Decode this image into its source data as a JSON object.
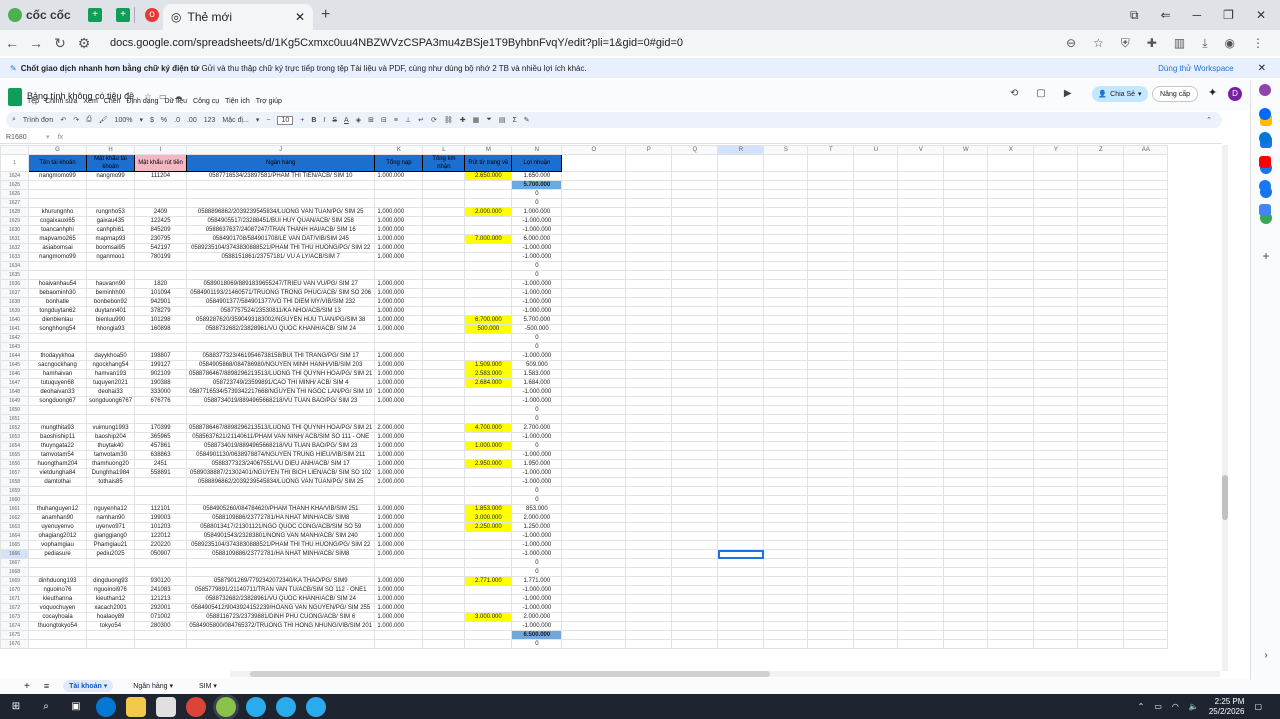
{
  "browser": {
    "brand": "cốc cốc",
    "active_tab": "Thẻ mới",
    "url": "docs.google.com/spreadsheets/d/1Kg5Cxmxc0uu4NBZWVzCSPA3mu4zBSje1T9ByhbnFvqY/edit?pli=1&gid=0#gid=0"
  },
  "banner": {
    "bold": "Chốt giao dịch nhanh hơn bằng chữ ký điện tử",
    "text": "Gửi và thu thập chữ ký trực tiếp trong tệp Tài liệu và PDF, cùng như dùng bộ nhớ 2 TB và nhiều lợi ích khác.",
    "cta": "Dùng thử Workspace"
  },
  "docs": {
    "title": "Bảng tính không có tiêu đề",
    "menu": [
      "Tệp",
      "Chỉnh sửa",
      "Xem",
      "Chèn",
      "Định dạng",
      "Dữ liệu",
      "Công cụ",
      "Tiện ích",
      "Trợ giúp"
    ],
    "share": "Chia Sẻ",
    "upgrade": "Nâng cấp",
    "avatar": "D"
  },
  "toolbar": {
    "search": "Trình đơn",
    "zoom": "100%",
    "pct": "%",
    "dec1": ".0",
    "dec2": ".00",
    "num": "123",
    "font": "Mặc đị...",
    "fontsize": "10"
  },
  "formula": {
    "cellref": "R1680",
    "fx": "fx"
  },
  "columns": [
    "G",
    "H",
    "I",
    "J",
    "K",
    "L",
    "M",
    "N",
    "O",
    "P",
    "Q",
    "R",
    "S",
    "T",
    "U",
    "V",
    "W",
    "X",
    "Y",
    "Z",
    "AA"
  ],
  "headers": {
    "g": "Tên tài khoản",
    "h": "Mật khẩu tài khoản",
    "i": "Mật khẩu rút tiền",
    "j": "Ngân hàng",
    "k": "Tổng nạp",
    "l": "Tổng km nhận",
    "m": "Rút từ trang về",
    "n": "Lợi nhuận"
  },
  "rows": [
    {
      "n": "1624",
      "g": "nangmomo99",
      "h": "nangmo99",
      "i": "111204",
      "j": "0587716534/23897581/PHAM THI TIEN/ACB/ SIM 10",
      "k": "1.000.000",
      "m": "2.650.000",
      "p": "1.650.000"
    },
    {
      "n": "1625",
      "p": "5.700.000",
      "blue": true
    },
    {
      "n": "1626",
      "p": "0"
    },
    {
      "n": "1627",
      "p": "0"
    },
    {
      "n": "1628",
      "g": "khurungnho",
      "h": "rungnho53",
      "i": "2409",
      "j": "0588896862/2039239545834/LUONG VAN TUAN/PG/ SIM 25",
      "k": "1.000.000",
      "m": "2.000.000",
      "p": "1.000.000"
    },
    {
      "n": "1629",
      "g": "cogaixauxi65",
      "h": "gaixau435",
      "i": "122425",
      "j": "0584905517/23288451/BUI HUY QUAN/ACB/ SIM 258",
      "k": "1.000.000",
      "p": "-1.000.000"
    },
    {
      "n": "1630",
      "g": "toancanhphi",
      "h": "canhphi61",
      "i": "845209",
      "j": "0588637637/24087247/TRAN THANH HAI/ACB/ SIM 16",
      "k": "1.000.000",
      "p": "-1.000.000"
    },
    {
      "n": "1631",
      "g": "mapvamo265",
      "h": "mapmap93",
      "i": "230795",
      "j": "0584901708/584901708/LE VAN DAT/VIB/SIM 245",
      "k": "1.000.000",
      "m": "7.000.000",
      "p": "6.000.000"
    },
    {
      "n": "1632",
      "g": "asiabomsai",
      "h": "boomsai95",
      "i": "542197",
      "j": "0589235104/3743830888521/PHAM THI THU HUONG/PG/ SIM 22",
      "k": "1.000.000",
      "p": "-1.000.000"
    },
    {
      "n": "1633",
      "g": "nangmomo99",
      "h": "nganmoo1",
      "i": "780199",
      "j": "0588151861/23757181/ VU A LY/ACB/SIM 7",
      "k": "1.000.000",
      "p": "-1.000.000"
    },
    {
      "n": "1634",
      "p": "0"
    },
    {
      "n": "1635",
      "p": "0"
    },
    {
      "n": "1636",
      "g": "hoaivanhau54",
      "h": "hauvann90",
      "i": "1820",
      "j": "0589018069/8891839655247/TRIEU VAN VU/PG/ SIM 27",
      "k": "1.000.000",
      "p": "-1.000.000"
    },
    {
      "n": "1637",
      "g": "bebaominh30",
      "h": "beminhh00",
      "i": "101094",
      "j": "0584901193/21460571/TRUONG TRONG PHUC/ACB/ SIM SỐ 206",
      "k": "1.000.000",
      "p": "-1.000.000"
    },
    {
      "n": "1638",
      "g": "bonhatle",
      "h": "bonbebon92",
      "i": "942901",
      "j": "0584901377/584901377/VO THI DIEM MY/VIB/SIM 232",
      "k": "1.000.000",
      "p": "-1.000.000"
    },
    {
      "n": "1639",
      "g": "tongduytan62",
      "h": "duytann401",
      "i": "378279",
      "j": "0587757524/23530811/KA NHO/ACB/SIM 13",
      "k": "1.000.000",
      "p": "-1.000.000"
    },
    {
      "n": "1640",
      "g": "dienbienlau",
      "h": "bienluu990",
      "i": "101298",
      "j": "0589287620/3590493183002/NGUYEN HUU TUAN/PG/SIM 38",
      "k": "1.000.000",
      "m": "6.700.000",
      "p": "5.700.000"
    },
    {
      "n": "1641",
      "g": "songhhong54",
      "h": "hhongla93",
      "i": "160898",
      "j": "0588732682/23828961/VU QUOC KHANH/ACB/ SIM 24",
      "k": "1.000.000",
      "m": "500.000",
      "p": "-500.000"
    },
    {
      "n": "1642",
      "p": "0"
    },
    {
      "n": "1643",
      "p": "0"
    },
    {
      "n": "1644",
      "g": "thodayykhoa",
      "h": "dayykhoa50",
      "i": "198807",
      "j": "0588377323/4619546738158/BUI THI TRANG/PG/ SIM 17",
      "k": "1.000.000",
      "p": "-1.000.000"
    },
    {
      "n": "1645",
      "g": "sacngockhang",
      "h": "ngockhang54",
      "i": "199127",
      "j": "0584905868/084786980/NGUYEN MINH HANH/VIB/SIM 203",
      "k": "1.000.000",
      "m": "1.509.000",
      "p": "509.000"
    },
    {
      "n": "1646",
      "g": "hamhaivan",
      "h": "hamvan193",
      "i": "902109",
      "j": "0588786467/8898296213513/LUONG THI QUYNH HOA/PG/ SIM 21",
      "k": "1.000.000",
      "m": "2.583.000",
      "p": "1.583.000"
    },
    {
      "n": "1647",
      "g": "tutuquyen68",
      "h": "tuquyen2021",
      "i": "190388",
      "j": "058723749/23599891/CAO THI MINH/ ACB/ SIM 4",
      "k": "1.000.000",
      "m": "2.684.000",
      "p": "1.684.000"
    },
    {
      "n": "1648",
      "g": "deohaivan33",
      "h": "deohai33",
      "i": "333000",
      "j": "0587716534/5739342217668/NGUYEN THI NGOC LAN/PG/ SIM 10",
      "k": "1.000.000",
      "p": "-1.000.000"
    },
    {
      "n": "1649",
      "g": "songduong67",
      "h": "songduong6767",
      "i": "676776",
      "j": "0588734019/8894965668218/VU TUAN BAO/PG/ SIM 23",
      "k": "1.000.000",
      "p": "-1.000.000"
    },
    {
      "n": "1650",
      "p": "0"
    },
    {
      "n": "1651",
      "p": "0"
    },
    {
      "n": "1652",
      "g": "mungthita93",
      "h": "vuimung1993",
      "i": "170399",
      "j": "0588786467/8898296213513/LUONG THI QUYNH HOA/PG/ SIM 21",
      "k": "2.000.000",
      "m": "4.700.000",
      "p": "2.700.000"
    },
    {
      "n": "1653",
      "g": "baoshiship11",
      "h": "baoship204",
      "i": "365965",
      "j": "0585637621/21140611/PHAM VAN NINH/ ACB/SIM SỐ 111 - ONE",
      "k": "1.000.000",
      "p": "-1.000.000"
    },
    {
      "n": "1654",
      "g": "thuyngata22",
      "h": "thuytak40",
      "i": "457861",
      "j": "0588734019/8894965668218/VU TUAN BAO/PG/ SIM 23",
      "k": "1.000.000",
      "m": "1.000.000",
      "p": "0"
    },
    {
      "n": "1655",
      "g": "tamvotam54",
      "h": "tamvotam30",
      "i": "638863",
      "j": "0584901130/0638978874/NGUYEN TRUNG HIEU/VIB/SIM 211",
      "k": "1.000.000",
      "p": "-1.000.000"
    },
    {
      "n": "1656",
      "g": "huongtham204",
      "h": "thamhuong20",
      "i": "2451",
      "j": "0588377323/24067551/VU DIEU ANH/ACB/ SIM 17",
      "k": "1.000.000",
      "m": "2.950.000",
      "p": "1.950.000"
    },
    {
      "n": "1657",
      "g": "vietdungha84",
      "h": "Dunghha1984",
      "i": "558891",
      "j": "0589038887/21302401/NGUYEN THI BICH LIEN/ACB/ SIM SỐ 102",
      "k": "1.000.000",
      "p": "-1.000.000"
    },
    {
      "n": "1658",
      "g": "damtothai",
      "h": "tothais85",
      "i": "",
      "j": "0588896862/2039239545834/LUONG VAN TUAN/PG/ SIM 25",
      "k": "1.000.000",
      "p": "-1.000.000"
    },
    {
      "n": "1659",
      "p": "0"
    },
    {
      "n": "1660",
      "p": "0"
    },
    {
      "n": "1661",
      "g": "thuhanguyen12",
      "h": "nguyenha12",
      "i": "112101",
      "j": "0584905260/084784620/PHAM THANH KHA/VIB/SIM 251",
      "k": "1.000.000",
      "m": "1.853.000",
      "p": "853.000"
    },
    {
      "n": "1662",
      "g": "anamhan90",
      "h": "namhan90",
      "i": "199003",
      "j": "0588109886/23772781/HA NHAT MINH/ACB/ SIM8",
      "k": "1.000.000",
      "m": "3.000.000",
      "p": "2.000.000"
    },
    {
      "n": "1663",
      "g": "uyenuyenvo",
      "h": "uyenvo971",
      "i": "101203",
      "j": "0588013417/21301121/NGO QUOC CONG/ACB/SIM SỐ 59",
      "k": "1.000.000",
      "m": "2.250.000",
      "p": "1.250.000"
    },
    {
      "n": "1664",
      "g": "ohagiang2012",
      "h": "gianggiang0",
      "i": "122012",
      "j": "0584901543/23283801/NONG VAN MANH/ACB/ SIM 240",
      "k": "1.000.000",
      "p": "-1.000.000"
    },
    {
      "n": "1665",
      "g": "vophamgiau",
      "h": "Phamgiau21",
      "i": "220220",
      "j": "0589235104/3743830888521/PHAM THI THU HUONG/PG/ SIM 22",
      "k": "1.000.000",
      "p": "-1.000.000"
    },
    {
      "n": "1666",
      "g": "pediasure",
      "h": "pediu2025",
      "i": "050907",
      "j": "0588109886/23772781/HA NHAT MINH/ACB/ SIM8",
      "k": "1.000.000",
      "p": "-1.000.000"
    },
    {
      "n": "1667",
      "p": "0"
    },
    {
      "n": "1668",
      "p": "0"
    },
    {
      "n": "1669",
      "g": "dinhduong193",
      "h": "dingduong93",
      "i": "930120",
      "j": "0587901269/7792342072340/KA THAO/PG/ SIM9",
      "k": "1.000.000",
      "m": "2.771.000",
      "p": "1.771.000"
    },
    {
      "n": "1670",
      "g": "nguoino76",
      "h": "nguoinoi976",
      "i": "241083",
      "j": "0585779891/21140711/TRAN VAN TU/ACB/SIM SỐ 112 - ONE1",
      "k": "1.000.000",
      "p": "-1.000.000"
    },
    {
      "n": "1671",
      "g": "kieuthanna",
      "h": "kieuthan12",
      "i": "121213",
      "j": "0588732682/23828961/VU QUOC KHANH/ACB/ SIM 24",
      "k": "1.000.000",
      "p": "-1.000.000"
    },
    {
      "n": "1672",
      "g": "voquochuyen",
      "h": "xacach2001",
      "i": "292001",
      "j": "0584905412/9043924152239/HOANG VAN NGUYEN/PG/ SIM 255",
      "k": "1.000.000",
      "p": "-1.000.000"
    },
    {
      "n": "1673",
      "g": "cocayhoala",
      "h": "hoalaoy89",
      "i": "071002",
      "j": "0588116723/23739881/DINH PHU CUONG/ACB/ SIM 6",
      "k": "1.000.000",
      "m": "3.000.000",
      "p": "2.000.000"
    },
    {
      "n": "1674",
      "g": "thuongtokyo54",
      "h": "tokyo54",
      "i": "280300",
      "j": "0584905800/084765372/TRUONG THI HONG NHUNG/VIB/SIM 201",
      "k": "1.000.000",
      "p": "-1.000.000"
    },
    {
      "n": "1675",
      "p": "6.500.000",
      "blue": true
    },
    {
      "n": "1676",
      "p": "0"
    }
  ],
  "sheets": [
    "Tài khoản",
    "Ngân hàng",
    "SIM"
  ],
  "taskbar": {
    "time": "2:25 PM",
    "date": "25/2/2026"
  },
  "colors": {
    "header_blue": "#1d6fcf",
    "header_pink": "#f4b6c2",
    "highlight": "#ffff00",
    "total_blue": "#6fa8dc"
  }
}
